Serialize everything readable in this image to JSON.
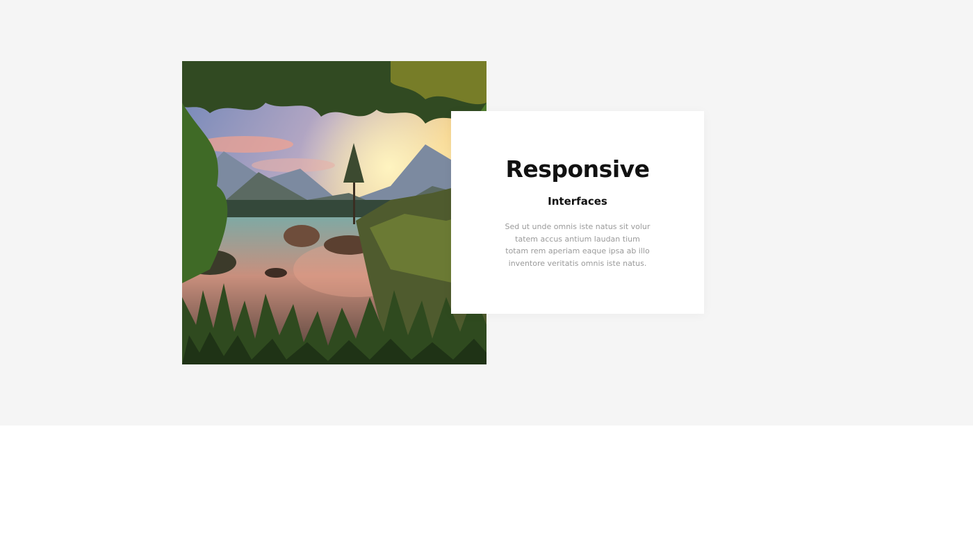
{
  "feature": {
    "image_alt": "Mountain lake at sunset framed by leaves and grass",
    "title": "Responsive",
    "subtitle": "Interfaces",
    "description": "Sed ut unde omnis iste natus sit volur tatem accus antium laudan tium totam rem aperiam eaque ipsa ab illo inventore veritatis omnis iste natus."
  },
  "colors": {
    "section_background": "#f5f5f5",
    "page_background": "#ffffff",
    "card_background": "#ffffff",
    "title_color": "#111111",
    "body_text_color": "#9a9a9a"
  }
}
